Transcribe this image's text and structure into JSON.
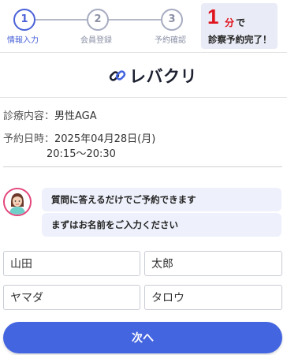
{
  "steps": [
    {
      "number": "1",
      "label": "情報入力",
      "active": true
    },
    {
      "number": "2",
      "label": "会員登録",
      "active": false
    },
    {
      "number": "3",
      "label": "予約確認",
      "active": false
    }
  ],
  "promo": {
    "number": "1",
    "unit": "分",
    "suffix": "で",
    "text": "診察予約完了！"
  },
  "logo": {
    "text": "レバクリ"
  },
  "appointment": {
    "content_label": "診療内容：",
    "content_value": "男性AGA",
    "datetime_label": "予約日時：",
    "date_value": "2025年04月28日(月)",
    "time_value": "20:15〜20:30"
  },
  "chat": {
    "message1": "質問に答えるだけでご予約できます",
    "message2": "まずはお名前をご入力ください"
  },
  "form": {
    "last_name": "山田",
    "first_name": "太郎",
    "last_name_kana": "ヤマダ",
    "first_name_kana": "タロウ"
  },
  "next_button": "次へ",
  "colors": {
    "accent": "#4465e0",
    "promo_red": "#e0141e",
    "avatar_ring": "#e4457a"
  }
}
